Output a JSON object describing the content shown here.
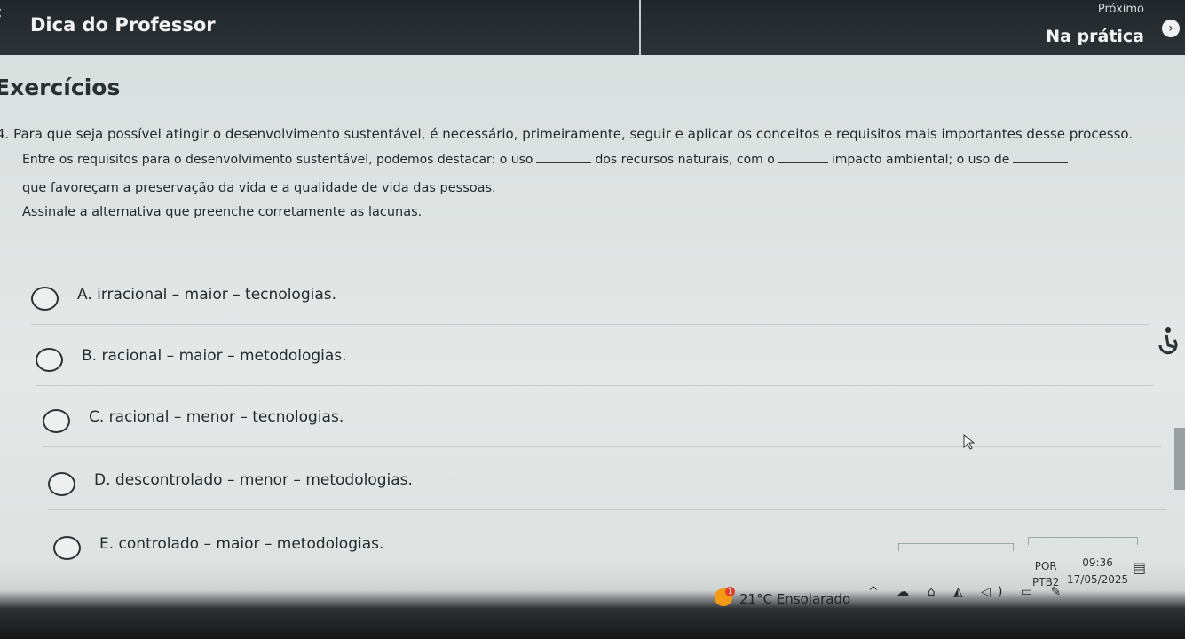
{
  "header": {
    "back_icon": "chevron-left-icon",
    "title": "Dica do Professor",
    "next_label": "Próximo",
    "next_title": "Na prática",
    "next_icon": "chevron-right-circle-icon"
  },
  "section": {
    "title": "Exercícios"
  },
  "question": {
    "line1": "4. Para que seja possível atingir o desenvolvimento sustentável, é necessário, primeiramente, seguir e aplicar os conceitos e requisitos mais importantes desse processo.",
    "line2_a": "Entre os requisitos para o desenvolvimento sustentável, podemos destacar: o uso",
    "line2_b": "dos recursos naturais, com o",
    "line2_c": "impacto ambiental; o uso de",
    "line3": "que favoreçam a preservação da vida e a qualidade de vida das pessoas.",
    "line4": "Assinale a alternativa que preenche corretamente as lacunas."
  },
  "options": [
    {
      "label": "A. irracional – maior – tecnologias."
    },
    {
      "label": "B. racional – maior – metodologias."
    },
    {
      "label": "C. racional – menor – tecnologias."
    },
    {
      "label": "D. descontrolado – menor – metodologias."
    },
    {
      "label": "E. controlado – maior – metodologias."
    }
  ],
  "taskbar": {
    "weather_badge": "1",
    "weather": "21°C  Ensolarado",
    "tray_icons": "^ ☁ ⌂ ◭ ◁) ▭ ✎",
    "lang_top": "POR",
    "lang_bottom": "PTB2",
    "time": "09:36",
    "date": "17/05/2025"
  }
}
